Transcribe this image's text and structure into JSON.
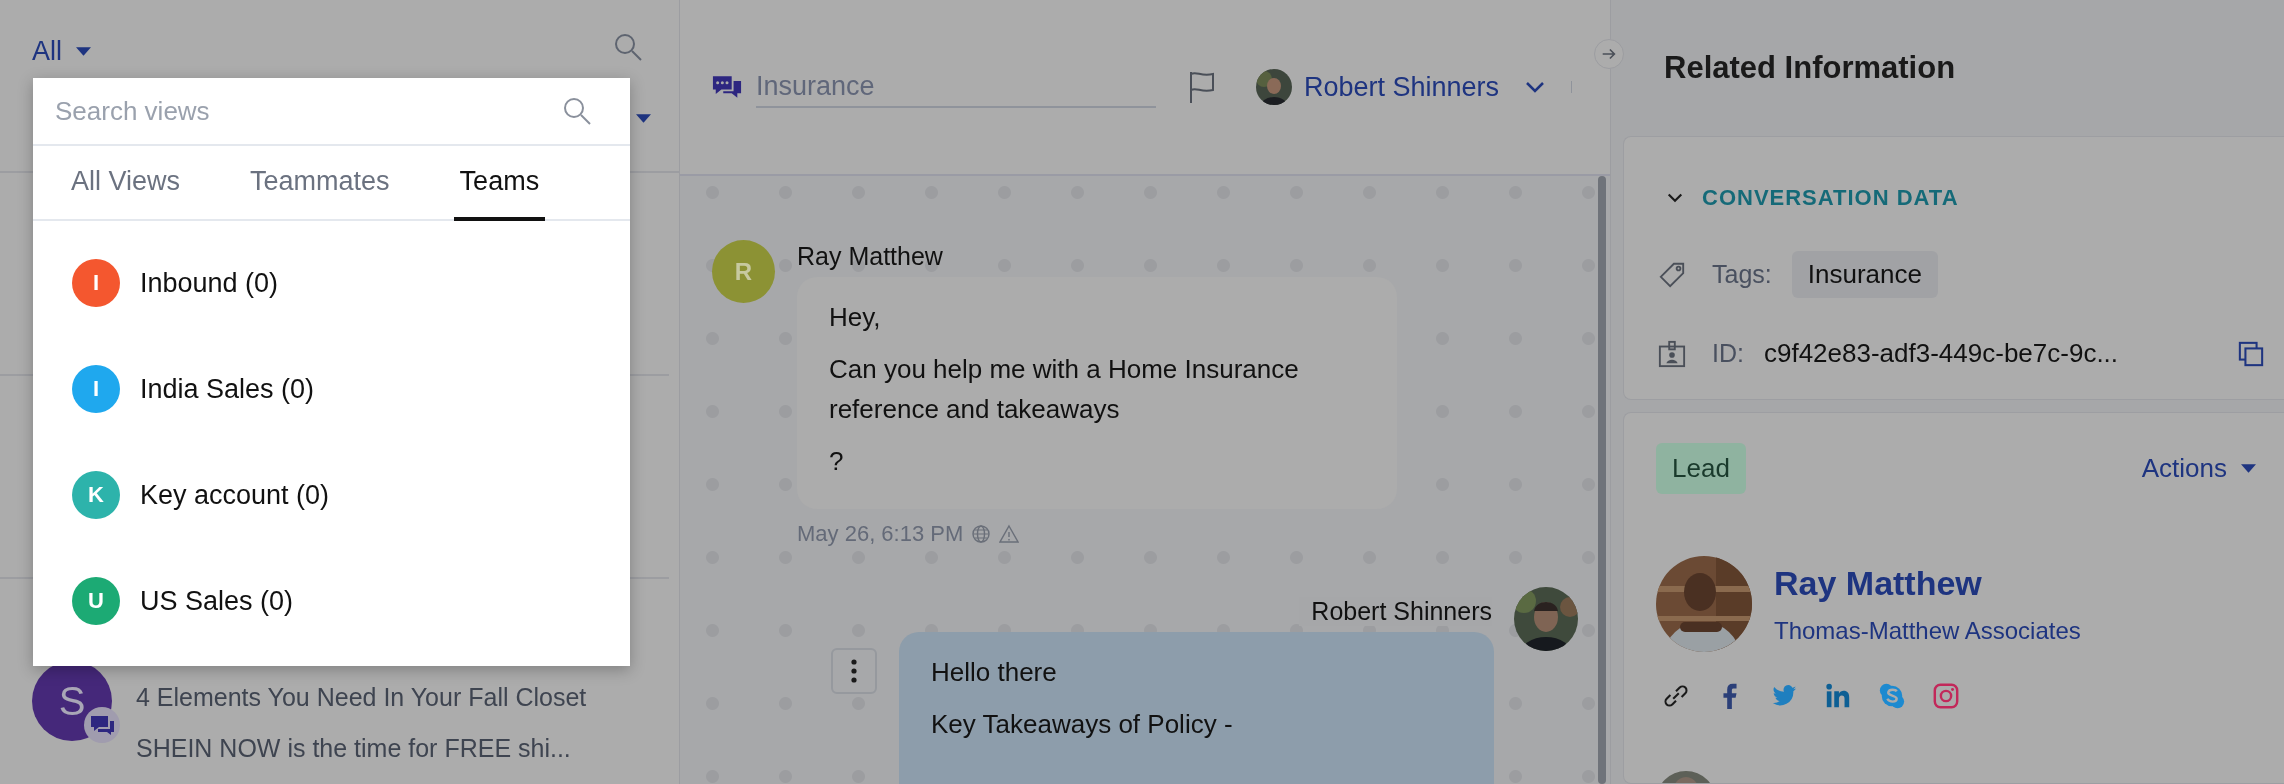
{
  "view_filter": {
    "label": "All"
  },
  "views_dropdown": {
    "search": {
      "placeholder": "Search views"
    },
    "tabs": [
      {
        "label": "All Views",
        "selected": false
      },
      {
        "label": "Teammates",
        "selected": false
      },
      {
        "label": "Teams",
        "selected": true
      }
    ],
    "items": [
      {
        "initial": "I",
        "label": "Inbound (0)",
        "color": "#f4572f"
      },
      {
        "initial": "I",
        "label": "India Sales (0)",
        "color": "#1fa8ee"
      },
      {
        "initial": "K",
        "label": "Key account (0)",
        "color": "#2db3ab"
      },
      {
        "initial": "U",
        "label": "US Sales (0)",
        "color": "#1caa74"
      }
    ]
  },
  "conversation_list": [
    {
      "initial": "S",
      "title": "4 Elements You Need In Your Fall Closet",
      "preview": "SHEIN NOW is the time for FREE shi..."
    }
  ],
  "conversation": {
    "subject": {
      "placeholder": "Insurance"
    },
    "assignee": "Robert Shinners",
    "messages": [
      {
        "kind": "incoming",
        "author": "Ray Matthew",
        "initial": "R",
        "lines": [
          "Hey,",
          "Can you help me with a Home Insurance reference and takeaways",
          "?"
        ],
        "time": "May 26, 6:13 PM"
      },
      {
        "kind": "outgoing",
        "author": "Robert Shinners",
        "lines": [
          "Hello there",
          "Key Takeaways of Policy -"
        ]
      }
    ]
  },
  "related": {
    "title": "Related Information",
    "conversation_data": {
      "title": "CONVERSATION DATA",
      "expanded": true,
      "tags_label": "Tags:",
      "tags": [
        "Insurance"
      ],
      "id_label": "ID:",
      "id": "c9f42e83-adf3-449c-be7c-9c..."
    },
    "contact": {
      "stage": "Lead",
      "actions": "Actions",
      "name": "Ray Matthew",
      "company": "Thomas-Matthew Associates"
    }
  }
}
